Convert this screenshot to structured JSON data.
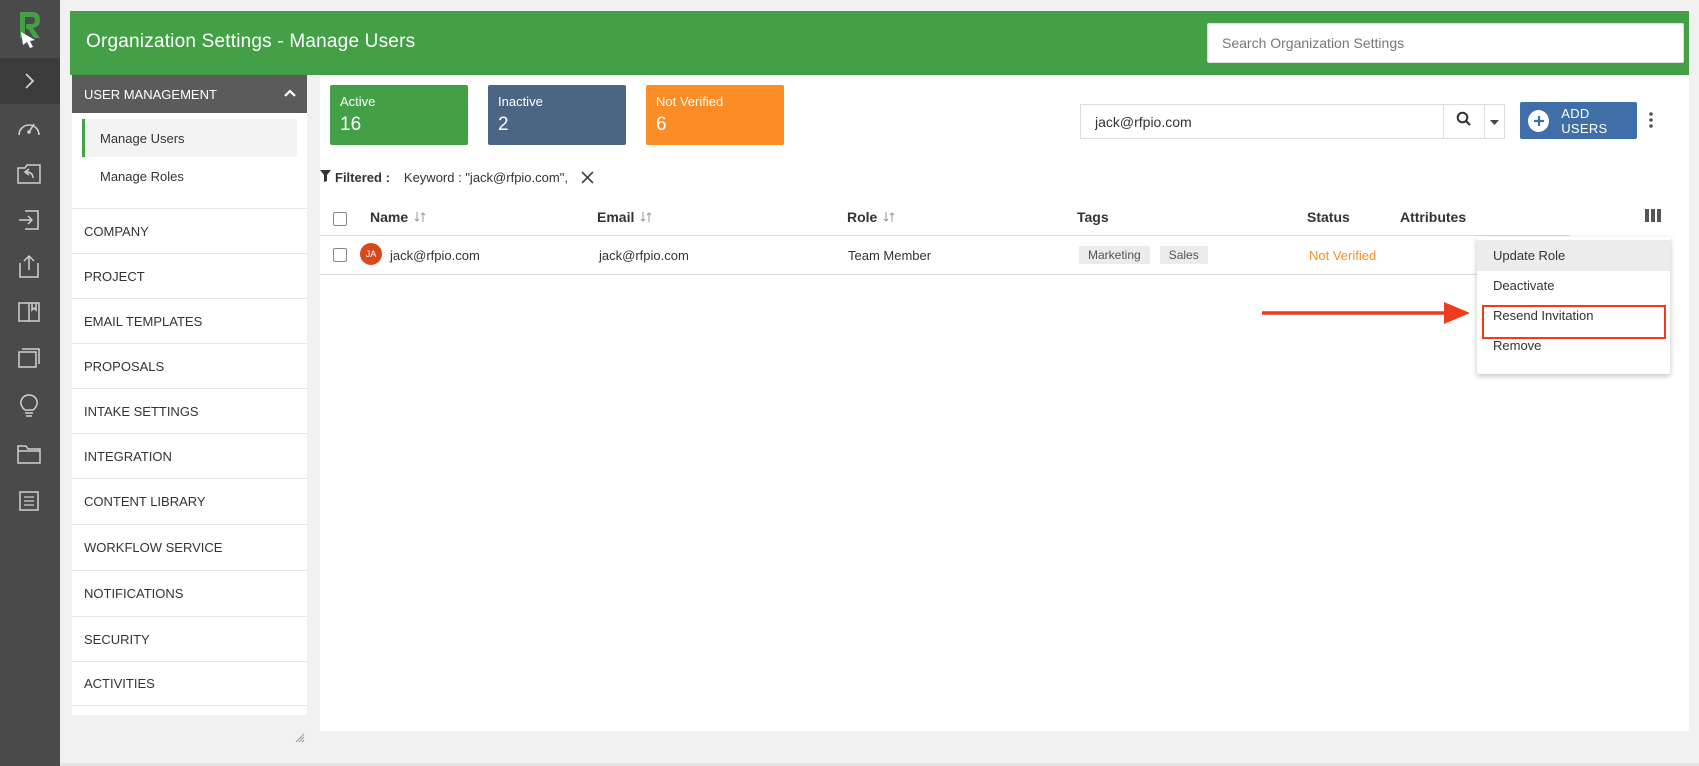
{
  "header": {
    "title": "Organization Settings - Manage Users",
    "search_placeholder": "Search Organization Settings"
  },
  "rail": {
    "icons": [
      "logo-r-icon",
      "chevron-right-icon",
      "dashboard-gauge-icon",
      "inbox-reply-icon",
      "import-icon",
      "export-icon",
      "book-icon",
      "windows-icon",
      "lightbulb-icon",
      "folder-icon",
      "document-list-icon"
    ]
  },
  "nav": {
    "section": "USER MANAGEMENT",
    "sub": [
      {
        "label": "Manage Users",
        "active": true
      },
      {
        "label": "Manage Roles",
        "active": false
      }
    ],
    "items": [
      "COMPANY",
      "PROJECT",
      "EMAIL TEMPLATES",
      "PROPOSALS",
      "INTAKE SETTINGS",
      "INTEGRATION",
      "CONTENT LIBRARY",
      "WORKFLOW SERVICE",
      "NOTIFICATIONS",
      "SECURITY",
      "ACTIVITIES"
    ]
  },
  "cards": [
    {
      "label": "Active",
      "value": "16",
      "color": "#43a047"
    },
    {
      "label": "Inactive",
      "value": "2",
      "color": "#4b6584"
    },
    {
      "label": "Not Verified",
      "value": "6",
      "color": "#fb8c26"
    }
  ],
  "search": {
    "value": "jack@rfpio.com"
  },
  "add_users_label": "ADD USERS",
  "filter": {
    "label": "Filtered :",
    "keyword": "Keyword : \"jack@rfpio.com\","
  },
  "table": {
    "headers": {
      "name": "Name",
      "email": "Email",
      "role": "Role",
      "tags": "Tags",
      "status": "Status",
      "attributes": "Attributes"
    },
    "row": {
      "initials": "JA",
      "name": "jack@rfpio.com",
      "email": "jack@rfpio.com",
      "role": "Team Member",
      "tags": [
        "Marketing",
        "Sales"
      ],
      "status": "Not Verified"
    }
  },
  "menu": {
    "items": [
      "Update Role",
      "Deactivate",
      "Resend Invitation",
      "Remove"
    ],
    "highlighted": "Resend Invitation"
  },
  "colors": {
    "brand_green": "#43a047",
    "rail": "#4a4a4a",
    "primary_blue": "#3f6ea9",
    "status_orange": "#fb8c26",
    "annotation_red": "#f03b1f"
  }
}
